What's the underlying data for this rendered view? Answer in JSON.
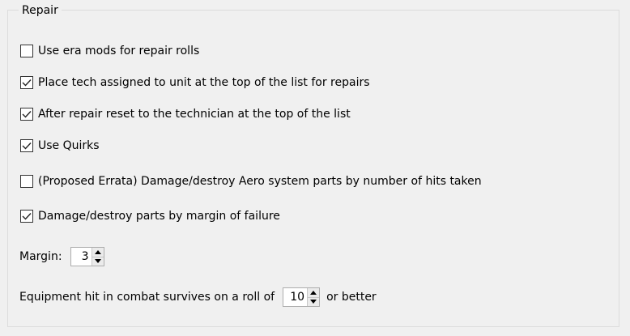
{
  "repair_group": {
    "title": "Repair",
    "options": [
      {
        "label": "Use era mods for repair rolls",
        "checked": false
      },
      {
        "label": "Place tech assigned to unit at the top of the list for repairs",
        "checked": true
      },
      {
        "label": "After repair reset to the technician at the top of the list",
        "checked": true
      },
      {
        "label": "Use Quirks",
        "checked": true
      },
      {
        "label": "(Proposed Errata) Damage/destroy Aero system parts by number of hits taken",
        "checked": false
      },
      {
        "label": "Damage/destroy parts by margin of failure",
        "checked": true
      }
    ],
    "margin": {
      "label": "Margin:",
      "value": "3"
    },
    "equipment_hit": {
      "label_before": "Equipment hit in combat survives on a roll of",
      "value": "10",
      "label_after": "or better"
    }
  },
  "icons": {
    "check": "checkmark-icon",
    "spin_up": "arrow-up-icon",
    "spin_down": "arrow-down-icon"
  },
  "colors": {
    "background": "#f0f0f0",
    "checkbox_border": "#333333",
    "group_border": "#dcdcdc"
  }
}
